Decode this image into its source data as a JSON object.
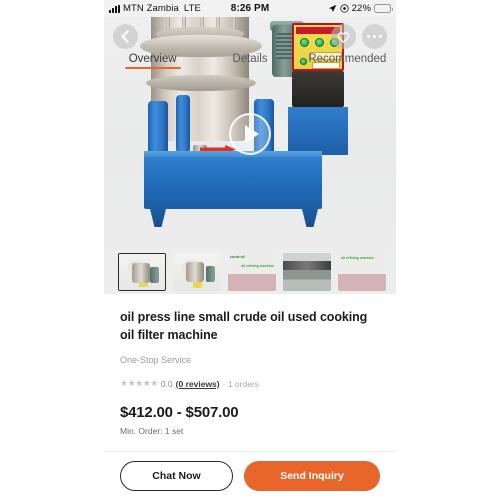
{
  "status_bar": {
    "carrier": "MTN Zambia",
    "network": "LTE",
    "time": "8:26 PM",
    "battery_percent": "22%",
    "signal_icon": "signal-bars-icon",
    "location_icon": "location-arrow-icon",
    "low_power_icon": "low-power-mode-icon",
    "battery_icon": "battery-icon",
    "battery_level": 22,
    "battery_color": "#f2c438"
  },
  "header": {
    "back_icon": "back-chevron-icon",
    "favorite_icon": "heart-icon",
    "more_icon": "more-dots-icon"
  },
  "tabs": {
    "items": [
      {
        "label": "Overview",
        "active": true
      },
      {
        "label": "Details",
        "active": false
      },
      {
        "label": "Recommended",
        "active": false
      }
    ],
    "accent_color": "#e8662a"
  },
  "gallery": {
    "play_icon": "play-button-icon",
    "thumbnails": [
      {
        "name": "thumbnail-1",
        "selected": true,
        "caption": ""
      },
      {
        "name": "thumbnail-2",
        "selected": false,
        "caption": ""
      },
      {
        "name": "thumbnail-3",
        "selected": false,
        "caption": "crude oil"
      },
      {
        "name": "thumbnail-4",
        "selected": false,
        "caption": ""
      },
      {
        "name": "thumbnail-5",
        "selected": false,
        "caption": "oil refining machine"
      }
    ],
    "thumb3_caption2": "oil refining machine"
  },
  "product": {
    "title": "oil press line small crude oil used cooking oil filter machine",
    "service_tag": "One-Stop Service",
    "rating_stars": "★★★★★",
    "rating_value": "0.0",
    "reviews_link": "(0 reviews)",
    "orders": "· 1 orders",
    "price": "$412.00 - $507.00",
    "min_order": "Min. Order: 1 set"
  },
  "bottom_bar": {
    "chat_label": "Chat Now",
    "inquiry_label": "Send Inquiry",
    "inquiry_color": "#e8662a"
  }
}
